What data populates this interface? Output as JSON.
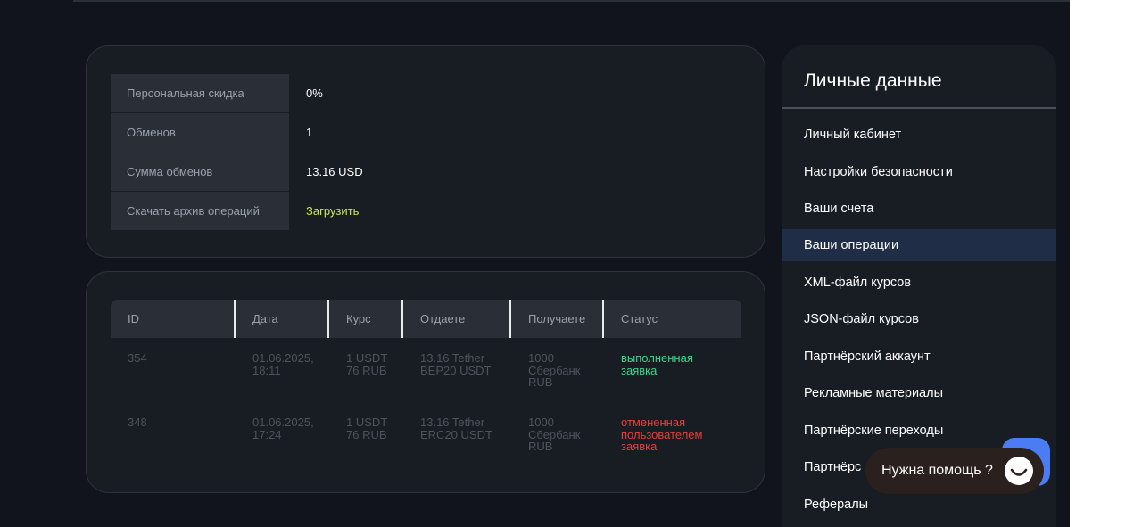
{
  "stats": [
    {
      "label": "Персональная скидка",
      "value": "0%"
    },
    {
      "label": "Обменов",
      "value": "1"
    },
    {
      "label": "Сумма обменов",
      "value": "13.16 USD"
    },
    {
      "label": "Скачать архив операций",
      "value": "Загрузить"
    }
  ],
  "operations": {
    "columns": [
      "ID",
      "Дата",
      "Курс",
      "Отдаете",
      "Получаете",
      "Статус"
    ],
    "rows": [
      {
        "id": "354",
        "date": [
          "01.06.2025,",
          "18:11"
        ],
        "rate": [
          "1 USDT",
          "76 RUB"
        ],
        "give": [
          "13.16 Tether",
          "BEP20 USDT"
        ],
        "get": [
          "1000",
          "Сбербанк",
          "RUB"
        ],
        "status": [
          "выполненная",
          "заявка"
        ],
        "status_color": "#3fd68c"
      },
      {
        "id": "348",
        "date": [
          "01.06.2025,",
          "17:24"
        ],
        "rate": [
          "1 USDT",
          "76 RUB"
        ],
        "give": [
          "13.16 Tether",
          "ERC20 USDT"
        ],
        "get": [
          "1000",
          "Сбербанк",
          "RUB"
        ],
        "status": [
          "отмененная",
          "пользователем",
          "заявка"
        ],
        "status_color": "#e2403c"
      }
    ]
  },
  "sidebar": {
    "title": "Личные данные",
    "items": [
      {
        "label": "Личный кабинет"
      },
      {
        "label": "Настройки безопасности"
      },
      {
        "label": "Ваши счета"
      },
      {
        "label": "Ваши операции",
        "active": true
      },
      {
        "label": "XML-файл курсов"
      },
      {
        "label": "JSON-файл курсов"
      },
      {
        "label": "Партнёрский аккаунт"
      },
      {
        "label": "Рекламные материалы"
      },
      {
        "label": "Партнёрские переходы"
      },
      {
        "label": "Партнёрс"
      },
      {
        "label": "Рефералы"
      }
    ]
  },
  "help_widget": {
    "label": "Нужна помощь ?",
    "icon": "chat-smile-icon"
  },
  "colors": {
    "background": "#11141c",
    "card": "#181c23",
    "accent_link": "#c8e84a",
    "status_done": "#3fd68c",
    "status_cancel": "#e2403c",
    "active_menu": "#1f2d46",
    "help_button": "#4b7cf3"
  }
}
